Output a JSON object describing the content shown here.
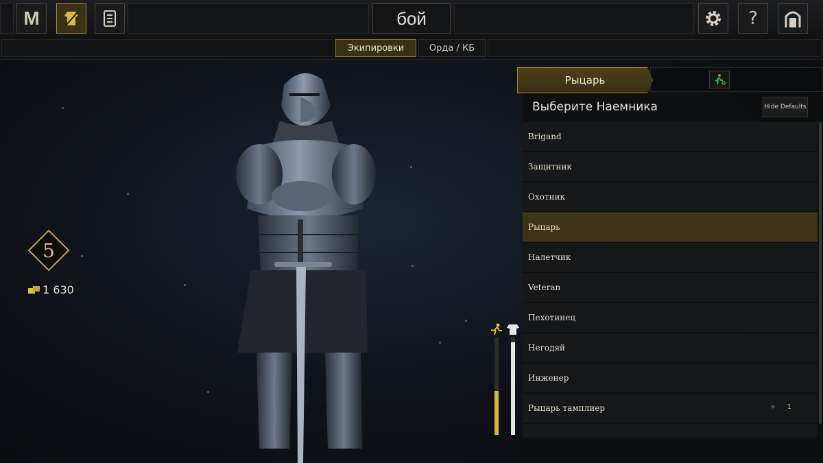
{
  "top_bar": {
    "logo_button": "M",
    "mode_title": "бой",
    "help_button": "?",
    "icons": [
      "loadouts-icon",
      "scroll-icon",
      "gear-icon",
      "help-icon",
      "exit-door-icon"
    ]
  },
  "sub_tabs": [
    {
      "label": "Экипировки",
      "active": true
    },
    {
      "label": "Орда / КБ",
      "active": false
    }
  ],
  "player": {
    "level": "5",
    "gold": "1 630"
  },
  "stats": {
    "speed_level": 0.45,
    "armor_level": 0.95
  },
  "panel": {
    "class_tab": "Рыцарь",
    "title": "Выберите Наемника",
    "hide_defaults": "Hide Defaults",
    "mercenaries": [
      {
        "name": "Brigand",
        "selected": false
      },
      {
        "name": "Защитник",
        "selected": false
      },
      {
        "name": "Охотник",
        "selected": false
      },
      {
        "name": "Рыцарь",
        "selected": true
      },
      {
        "name": "Налетчик",
        "selected": false
      },
      {
        "name": "Veteran",
        "selected": false
      },
      {
        "name": "Пехотинец",
        "selected": false
      },
      {
        "name": "Негодяй",
        "selected": false
      },
      {
        "name": "Инженер",
        "selected": false
      },
      {
        "name": "Рыцарь тамплиер",
        "selected": false,
        "quantity": "1"
      }
    ]
  },
  "colors": {
    "accent_gold": "#a88c3c",
    "selected_row": "#3e3319",
    "run_icon_green": "#3fae3f"
  }
}
